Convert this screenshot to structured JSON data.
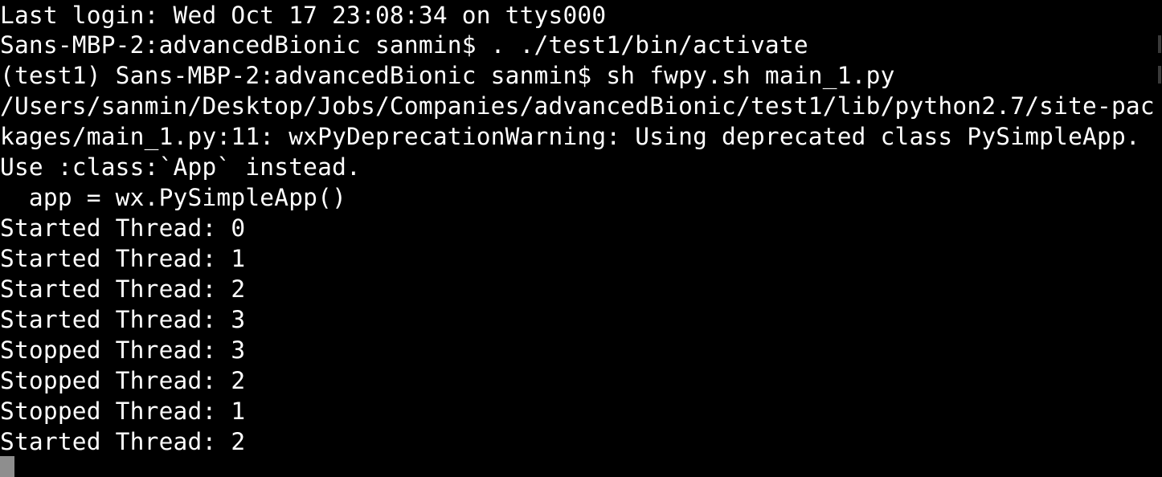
{
  "terminal": {
    "lines": [
      "Last login: Wed Oct 17 23:08:34 on ttys000",
      "Sans-MBP-2:advancedBionic sanmin$ . ./test1/bin/activate",
      "(test1) Sans-MBP-2:advancedBionic sanmin$ sh fwpy.sh main_1.py",
      "/Users/sanmin/Desktop/Jobs/Companies/advancedBionic/test1/lib/python2.7/site-pac",
      "kages/main_1.py:11: wxPyDeprecationWarning: Using deprecated class PySimpleApp.",
      "Use :class:`App` instead.",
      "  app = wx.PySimpleApp()",
      "Started Thread: 0",
      "Started Thread: 1",
      "Started Thread: 2",
      "Started Thread: 3",
      "Stopped Thread: 3",
      "Stopped Thread: 2",
      "Stopped Thread: 1",
      "Started Thread: 2"
    ]
  },
  "colors": {
    "background": "#000000",
    "text": "#ffffff",
    "cursor": "#8e8e8e"
  }
}
